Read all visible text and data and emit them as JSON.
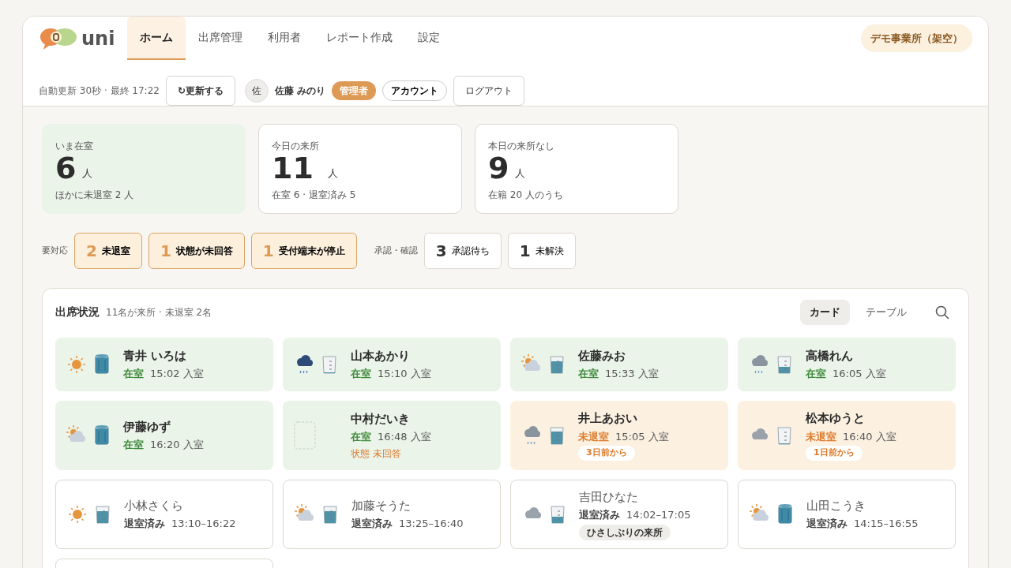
{
  "brand": {
    "name": "uni"
  },
  "nav": [
    {
      "label": "ホーム",
      "selected": true
    },
    {
      "label": "出席管理",
      "selected": false
    },
    {
      "label": "利用者",
      "selected": false
    },
    {
      "label": "レポート作成",
      "selected": false
    },
    {
      "label": "設定",
      "selected": false
    }
  ],
  "office": "デモ事業所（架空）",
  "toolbar": {
    "auto_refresh": "自動更新 30秒 · 最終 17:22",
    "refresh_button": "↻更新する",
    "avatar": "佐",
    "user": "佐藤 みのり",
    "role": "管理者",
    "account": "アカウント",
    "logout": "ログアウト"
  },
  "stats": [
    {
      "label": "いま在室",
      "value": "6",
      "unit": "人",
      "sub": "ほかに未退室 2 人",
      "highlight": true
    },
    {
      "label": "今日の来所",
      "value": "11",
      "unit": "人",
      "sub": "在室 6 · 退室済み 5",
      "highlight": false
    },
    {
      "label": "本日の来所なし",
      "value": "9",
      "unit": "人",
      "sub": "在籍 20 人のうち",
      "highlight": false
    }
  ],
  "alerts": {
    "label": "要対応",
    "items": [
      {
        "count": "2",
        "text": "未退室"
      },
      {
        "count": "1",
        "text": "状態が未回答"
      },
      {
        "count": "1",
        "text": "受付端末が停止"
      }
    ]
  },
  "approvals": {
    "label": "承認・確認",
    "items": [
      {
        "count": "3",
        "text": "承認待ち"
      },
      {
        "count": "1",
        "text": "未解決"
      }
    ]
  },
  "attendance": {
    "title": "出席状況",
    "summary": "11名が来所 · 未退室 2名",
    "views": [
      {
        "label": "カード",
        "selected": true
      },
      {
        "label": "テーブル",
        "selected": false
      }
    ],
    "cards": [
      {
        "kind": "in",
        "name": "青井 いろは",
        "status": "在室",
        "time": "15:02 入室",
        "icons": [
          {
            "kind": "sun"
          },
          {
            "kind": "tall",
            "level": 0.9
          }
        ]
      },
      {
        "kind": "in",
        "name": "山本あかり",
        "status": "在室",
        "time": "15:10 入室",
        "icons": [
          {
            "kind": "rain"
          },
          {
            "kind": "glass",
            "level": 0.05
          }
        ]
      },
      {
        "kind": "in",
        "name": "佐藤みお",
        "status": "在室",
        "time": "15:33 入室",
        "icons": [
          {
            "kind": "partly"
          },
          {
            "kind": "glass",
            "level": 0.75
          }
        ]
      },
      {
        "kind": "in",
        "name": "高橋れん",
        "status": "在室",
        "time": "16:05 入室",
        "icons": [
          {
            "kind": "raingray"
          },
          {
            "kind": "glass",
            "level": 0.4
          }
        ]
      },
      {
        "kind": "in",
        "name": "伊藤ゆず",
        "status": "在室",
        "time": "16:20 入室",
        "icons": [
          {
            "kind": "partly"
          },
          {
            "kind": "tall",
            "level": 0.9
          }
        ]
      },
      {
        "kind": "in",
        "name": "中村だいき",
        "status": "在室",
        "time": "16:48 入室",
        "icons": [
          {
            "kind": "empty"
          }
        ],
        "note": "状態 未回答"
      },
      {
        "kind": "not_out",
        "name": "井上あおい",
        "status": "未退室",
        "time": "15:05 入室",
        "icons": [
          {
            "kind": "raingray"
          },
          {
            "kind": "glass",
            "level": 0.8
          }
        ],
        "badge": "3日前から"
      },
      {
        "kind": "not_out",
        "name": "松本ゆうと",
        "status": "未退室",
        "time": "16:40 入室",
        "icons": [
          {
            "kind": "cloud"
          },
          {
            "kind": "glass",
            "level": 0.05
          }
        ],
        "badge": "1日前から"
      },
      {
        "kind": "left",
        "name": "小林さくら",
        "status": "退室済み",
        "time": "13:10–16:22",
        "icons": [
          {
            "kind": "sun"
          },
          {
            "kind": "glass",
            "level": 0.75
          }
        ]
      },
      {
        "kind": "left",
        "name": "加藤そうた",
        "status": "退室済み",
        "time": "13:25–16:40",
        "icons": [
          {
            "kind": "partly"
          },
          {
            "kind": "glass",
            "level": 0.75
          }
        ]
      },
      {
        "kind": "left",
        "name": "吉田ひなた",
        "status": "退室済み",
        "time": "14:02–17:05",
        "icons": [
          {
            "kind": "cloud"
          },
          {
            "kind": "glass",
            "level": 0.4
          }
        ],
        "tag": "ひさしぶりの来所"
      },
      {
        "kind": "left",
        "name": "山田こうき",
        "status": "退室済み",
        "time": "14:15–16:55",
        "icons": [
          {
            "kind": "partly"
          },
          {
            "kind": "tall",
            "level": 0.9
          }
        ]
      },
      {
        "kind": "cut"
      }
    ]
  }
}
